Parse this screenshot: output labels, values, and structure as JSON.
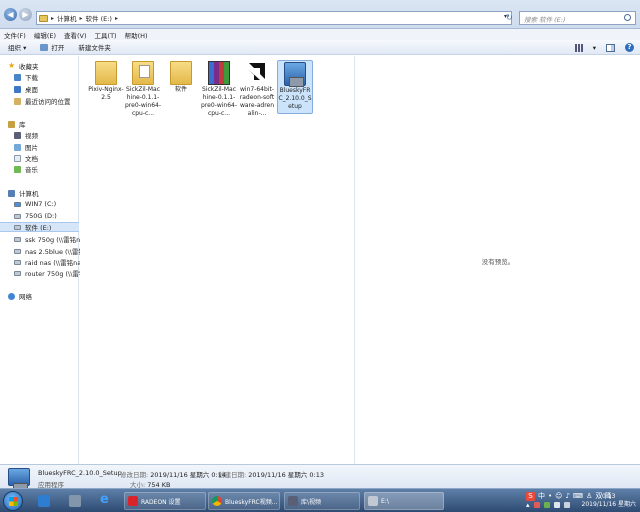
{
  "address": {
    "breadcrumb": [
      "计算机",
      "软件 (E:)"
    ],
    "search_placeholder": "搜索 软件 (E:)"
  },
  "menu": [
    "文件(F)",
    "编辑(E)",
    "查看(V)",
    "工具(T)",
    "帮助(H)"
  ],
  "toolbar": {
    "organize": "组织 ▾",
    "open": "打开",
    "new_folder": "新建文件夹"
  },
  "nav": {
    "favorites": "收藏夹",
    "downloads": "下载",
    "desktop": "桌面",
    "recent": "最近访问的位置",
    "libraries": "库",
    "videos": "视频",
    "pictures": "图片",
    "documents": "文档",
    "music": "音乐",
    "computer": "计算机",
    "drive_c": "WIN7 (C:)",
    "drive_d": "750G (D:)",
    "drive_e": "软件 (E:)",
    "net1": "ssk 750g (\\\\雷铭nas",
    "net2": "nas 2.5blue (\\\\雷铭",
    "net3": "raid nas (\\\\雷铭nas",
    "net4": "router 750g (\\\\雷铭",
    "network": "网络"
  },
  "files": [
    {
      "name": "Pixiv-Nginx-2.5",
      "icon": "folder"
    },
    {
      "name": "SickZil-Machine-0.1.1-pre0-win64-cpu-c...",
      "icon": "folder-doc"
    },
    {
      "name": "软件",
      "icon": "folder"
    },
    {
      "name": "SickZil-Machine-0.1.1-pre0-win64-cpu-c...",
      "icon": "winrar-archive"
    },
    {
      "name": "win7-64bit-radeon-software-adrenalin-...",
      "icon": "amd-logo"
    },
    {
      "name": "BlueskyFRC_2.10.0_Setup",
      "icon": "setup-installer"
    }
  ],
  "preview": {
    "empty_text": "没有预览。"
  },
  "details": {
    "name": "BlueskyFRC_2.10.0_Setup",
    "type": "应用程序",
    "modified_label": "修改日期:",
    "modified": "2019/11/16 星期六 0:14",
    "created_label": "创建日期:",
    "created": "2019/11/16 星期六 0:13",
    "size_label": "大小:",
    "size": "754 KB"
  },
  "taskbar": {
    "tasks": [
      "RADEON 设置",
      "BlueskyFRC视频...",
      "库\\视频",
      "E:\\"
    ],
    "tray_text": "中",
    "tray_right": "双 简",
    "time": "0:13",
    "date": "2019/11/16 星期六"
  },
  "colors": {
    "accent": "#3a6fb0",
    "selection": "#cce4fb",
    "taskbar": "#2e4b72"
  }
}
